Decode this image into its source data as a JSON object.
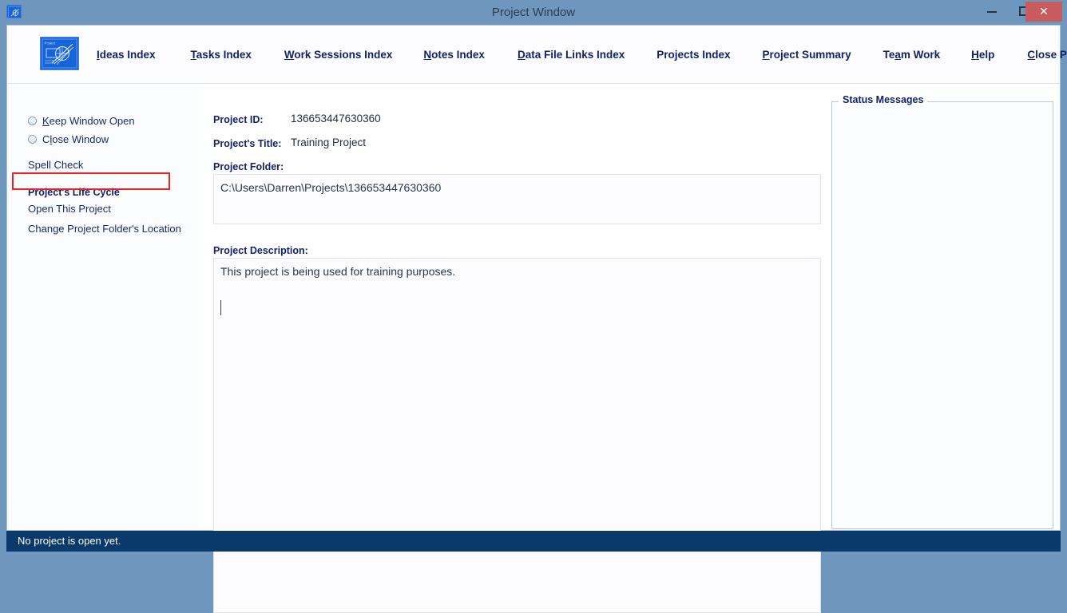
{
  "window": {
    "title": "Project Window",
    "icon": "project-logo-icon",
    "controls": {
      "minimize": "Minimize",
      "maximize": "Maximize",
      "close": "Close"
    },
    "close_color": "#c75b5e",
    "titlebar_color": "#6f96bc"
  },
  "header": {
    "logo_label": "Project",
    "menu": [
      {
        "label": "Ideas Index",
        "accel": "I",
        "accel_index": 0
      },
      {
        "label": "Tasks Index",
        "accel": "T",
        "accel_index": 0
      },
      {
        "label": "Work Sessions Index",
        "accel": "W",
        "accel_index": 0
      },
      {
        "label": "Notes Index",
        "accel": "N",
        "accel_index": 0
      },
      {
        "label": "Data File Links Index",
        "accel": "D",
        "accel_index": 0
      },
      {
        "label": "Projects Index",
        "accel": "",
        "accel_index": -1
      },
      {
        "label": "Project Summary",
        "accel": "P",
        "accel_index": 0
      },
      {
        "label": "Team Work",
        "accel": "a",
        "accel_index": 2
      },
      {
        "label": "Help",
        "accel": "H",
        "accel_index": 0
      },
      {
        "label": "Close Program",
        "accel": "C",
        "accel_index": 0
      }
    ]
  },
  "sidebar": {
    "radios": [
      {
        "label": "Keep Window Open",
        "accel_index": 0,
        "selected": false
      },
      {
        "label": "Close Window",
        "accel_index": 1,
        "selected": false
      }
    ],
    "spell_check": "Spell Check",
    "life_cycle_heading": "Project's Life Cycle",
    "actions": [
      {
        "label": "Open This Project",
        "highlighted": true
      },
      {
        "label": "Change Project Folder's Location",
        "highlighted": false
      }
    ],
    "highlight_color": "#ee2222"
  },
  "main": {
    "project_id_label": "Project ID:",
    "project_id_value": "136653447630360",
    "project_title_label": "Project's Title:",
    "project_title_value": "Training Project",
    "project_folder_label": "Project Folder:",
    "project_folder_value": "C:\\Users\\Darren\\Projects\\136653447630360",
    "project_description_label": "Project Description:",
    "project_description_value": "This project is being used for training purposes."
  },
  "status_panel": {
    "legend": "Status Messages",
    "messages": []
  },
  "statusbar": {
    "message": "No project is open yet."
  }
}
